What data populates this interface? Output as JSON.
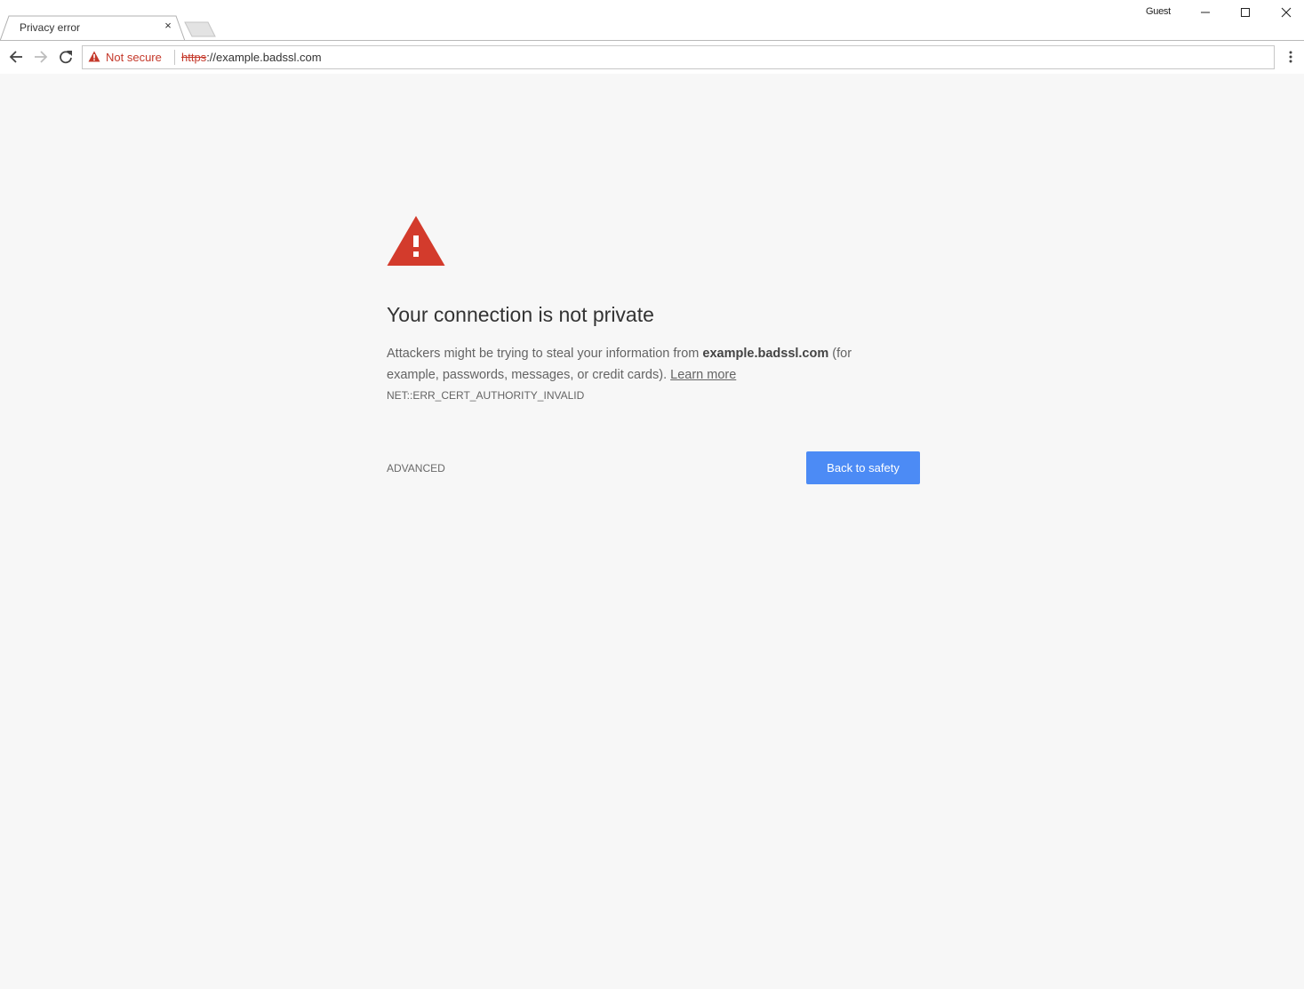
{
  "window": {
    "profile_label": "Guest"
  },
  "tab": {
    "title": "Privacy error",
    "close_glyph": "×"
  },
  "omnibox": {
    "security_label": "Not secure",
    "url_scheme": "https",
    "url_rest": "://example.badssl.com"
  },
  "interstitial": {
    "heading": "Your connection is not private",
    "msg_before": "Attackers might be trying to steal your information from ",
    "msg_host": "example.badssl.com",
    "msg_after": " (for example, passwords, messages, or credit cards). ",
    "learn_more": "Learn more",
    "error_code": "NET::ERR_CERT_AUTHORITY_INVALID",
    "advanced_label": "ADVANCED",
    "primary_label": "Back to safety"
  },
  "colors": {
    "warning_red": "#d33b2c",
    "primary_blue": "#4c8bf5",
    "page_bg": "#f7f7f7",
    "insecure_red": "#c5392b"
  }
}
